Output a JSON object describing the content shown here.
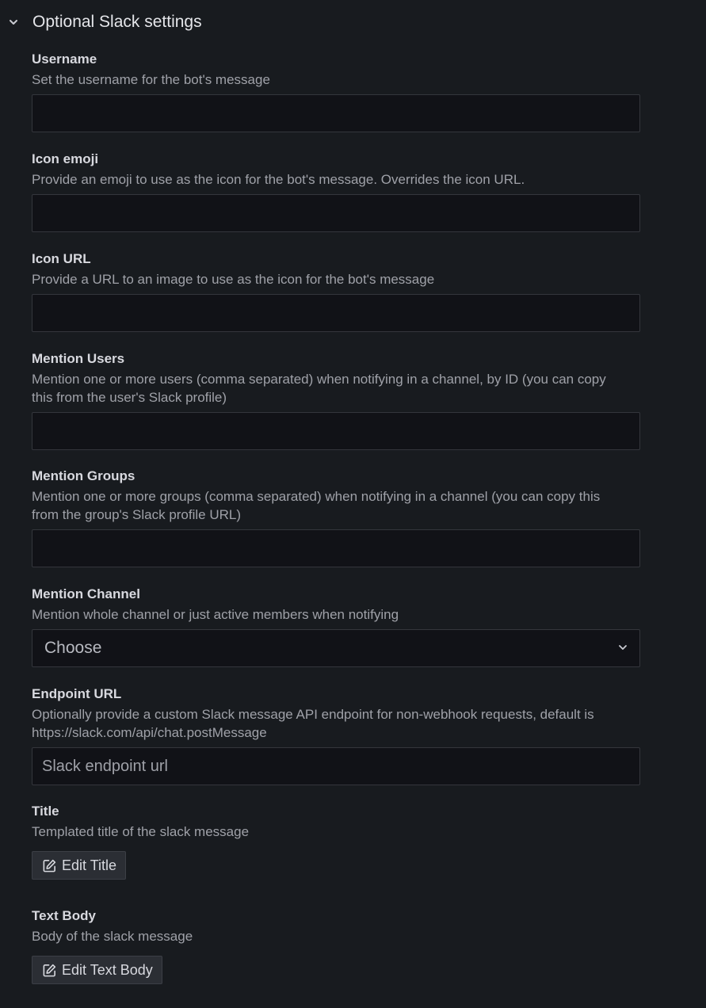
{
  "section": {
    "title": "Optional Slack settings",
    "chevron_icon": "chevron-down-icon"
  },
  "fields": {
    "username": {
      "label": "Username",
      "description": "Set the username for the bot's message",
      "value": "",
      "placeholder": ""
    },
    "icon_emoji": {
      "label": "Icon emoji",
      "description": "Provide an emoji to use as the icon for the bot's message. Overrides the icon URL.",
      "value": "",
      "placeholder": ""
    },
    "icon_url": {
      "label": "Icon URL",
      "description": "Provide a URL to an image to use as the icon for the bot's message",
      "value": "",
      "placeholder": ""
    },
    "mention_users": {
      "label": "Mention Users",
      "description": "Mention one or more users (comma separated) when notifying in a channel, by ID (you can copy this from the user's Slack profile)",
      "value": "",
      "placeholder": ""
    },
    "mention_groups": {
      "label": "Mention Groups",
      "description": "Mention one or more groups (comma separated) when notifying in a channel (you can copy this from the group's Slack profile URL)",
      "value": "",
      "placeholder": ""
    },
    "mention_channel": {
      "label": "Mention Channel",
      "description": "Mention whole channel or just active members when notifying",
      "selected": "Choose"
    },
    "endpoint_url": {
      "label": "Endpoint URL",
      "description": "Optionally provide a custom Slack message API endpoint for non-webhook requests, default is https://slack.com/api/chat.postMessage",
      "value": "",
      "placeholder": "Slack endpoint url"
    },
    "title": {
      "label": "Title",
      "description": "Templated title of the slack message",
      "button_label": "Edit Title"
    },
    "text_body": {
      "label": "Text Body",
      "description": "Body of the slack message",
      "button_label": "Edit Text Body"
    }
  },
  "colors": {
    "background": "#181b1f",
    "input_background": "#111217",
    "input_border": "#34363c",
    "label": "#d8d9df",
    "description": "#9fa1a8"
  }
}
